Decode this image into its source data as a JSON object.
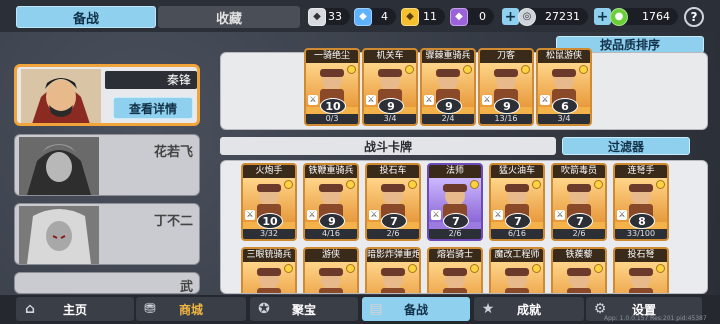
{
  "tabs": {
    "active": "备战",
    "inactive": "收藏"
  },
  "resources": [
    {
      "icon": "silver-gem-icon",
      "value": "33",
      "color": "#d7dbe0"
    },
    {
      "icon": "blue-gem-icon",
      "value": "4",
      "color": "#5fb2ff"
    },
    {
      "icon": "gold-gem-icon",
      "value": "11",
      "color": "#f4c02f"
    },
    {
      "icon": "purple-gem-icon",
      "value": "0",
      "color": "#9b63d9"
    }
  ],
  "currency": [
    {
      "icon": "coin-icon",
      "value": "27231"
    },
    {
      "icon": "green-gem-icon",
      "value": "1764"
    }
  ],
  "help_label": "?",
  "heroes": [
    {
      "name": "秦锋",
      "selected": true
    },
    {
      "name": "花若飞"
    },
    {
      "name": "丁不二"
    },
    {
      "name": "武"
    }
  ],
  "detail_button": "查看详情",
  "sort_button": "按品质排序",
  "deck_cards": [
    {
      "name": "一骑绝尘",
      "cost": "10",
      "level": "0/3"
    },
    {
      "name": "机关车",
      "cost": "9",
      "level": "3/4"
    },
    {
      "name": "骤棘重骑兵",
      "cost": "9",
      "level": "2/4"
    },
    {
      "name": "刀客",
      "cost": "9",
      "level": "13/16"
    },
    {
      "name": "松鼠游侠",
      "cost": "6",
      "level": "3/4"
    }
  ],
  "section_title": "战斗卡牌",
  "filter_button": "过滤器",
  "collection_cards": [
    {
      "name": "火炮手",
      "cost": "10",
      "level": "3/32",
      "epic": false
    },
    {
      "name": "铁鞭重骑兵",
      "cost": "9",
      "level": "4/16",
      "epic": false
    },
    {
      "name": "投石车",
      "cost": "7",
      "level": "2/6",
      "epic": false
    },
    {
      "name": "法师",
      "cost": "7",
      "level": "2/6",
      "epic": true
    },
    {
      "name": "猛火油车",
      "cost": "7",
      "level": "6/16",
      "epic": false
    },
    {
      "name": "吹箭毒员",
      "cost": "7",
      "level": "2/6",
      "epic": false
    },
    {
      "name": "连弩手",
      "cost": "8",
      "level": "33/100",
      "epic": false
    },
    {
      "name": "三眼铳骑兵",
      "cost": "",
      "level": "",
      "epic": false
    },
    {
      "name": "游侠",
      "cost": "",
      "level": "",
      "epic": false
    },
    {
      "name": "暗影炸弹重炮",
      "cost": "",
      "level": "",
      "epic": false
    },
    {
      "name": "熔岩骑士",
      "cost": "",
      "level": "",
      "epic": false
    },
    {
      "name": "魔改工程师",
      "cost": "",
      "level": "",
      "epic": false
    },
    {
      "name": "铁蒺藜",
      "cost": "",
      "level": "",
      "epic": false
    },
    {
      "name": "投石弩",
      "cost": "",
      "level": "",
      "epic": false
    }
  ],
  "nav": [
    {
      "label": "主页",
      "icon": "castle-icon"
    },
    {
      "label": "商城",
      "icon": "shop-icon"
    },
    {
      "label": "聚宝",
      "icon": "treasure-icon"
    },
    {
      "label": "备战",
      "icon": "cards-icon"
    },
    {
      "label": "成就",
      "icon": "achievement-icon"
    },
    {
      "label": "设置",
      "icon": "gear-icon"
    }
  ],
  "version": "App: 1.0.0.157 Res:201 pid:45387"
}
